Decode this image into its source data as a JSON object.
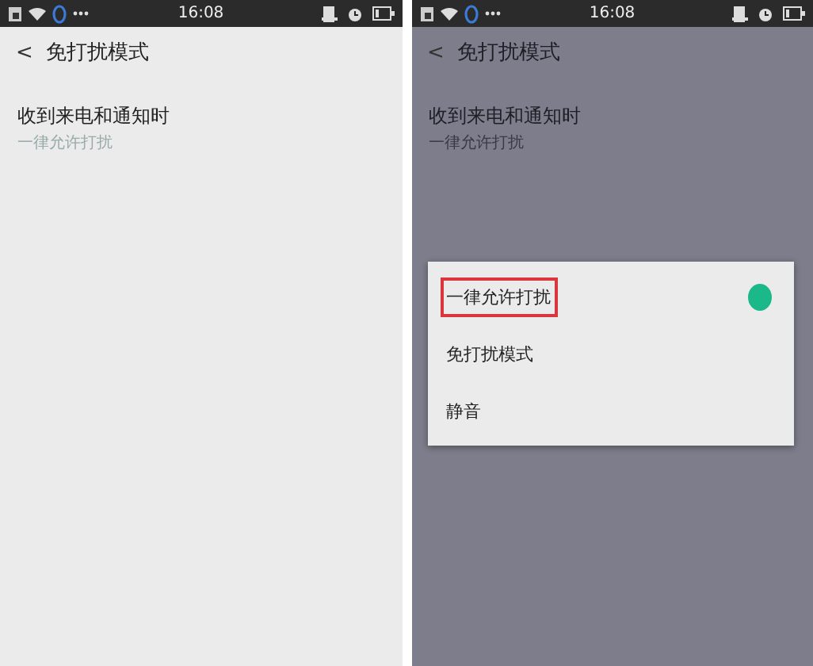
{
  "screens": [
    {
      "status_bar": {
        "time": "16:08"
      },
      "header": {
        "back": "<",
        "title": "免打扰模式"
      },
      "setting": {
        "label": "收到来电和通知时",
        "value": "一律允许打扰"
      },
      "dimmed": false
    },
    {
      "status_bar": {
        "time": "16:08"
      },
      "header": {
        "back": "<",
        "title": "免打扰模式"
      },
      "setting": {
        "label": "收到来电和通知时",
        "value": "一律允许打扰"
      },
      "dimmed": true,
      "dialog": {
        "options": [
          {
            "label": "一律允许打扰",
            "selected": true,
            "highlighted": true
          },
          {
            "label": "免打扰模式",
            "selected": false,
            "highlighted": false
          },
          {
            "label": "静音",
            "selected": false,
            "highlighted": false
          }
        ]
      }
    }
  ]
}
